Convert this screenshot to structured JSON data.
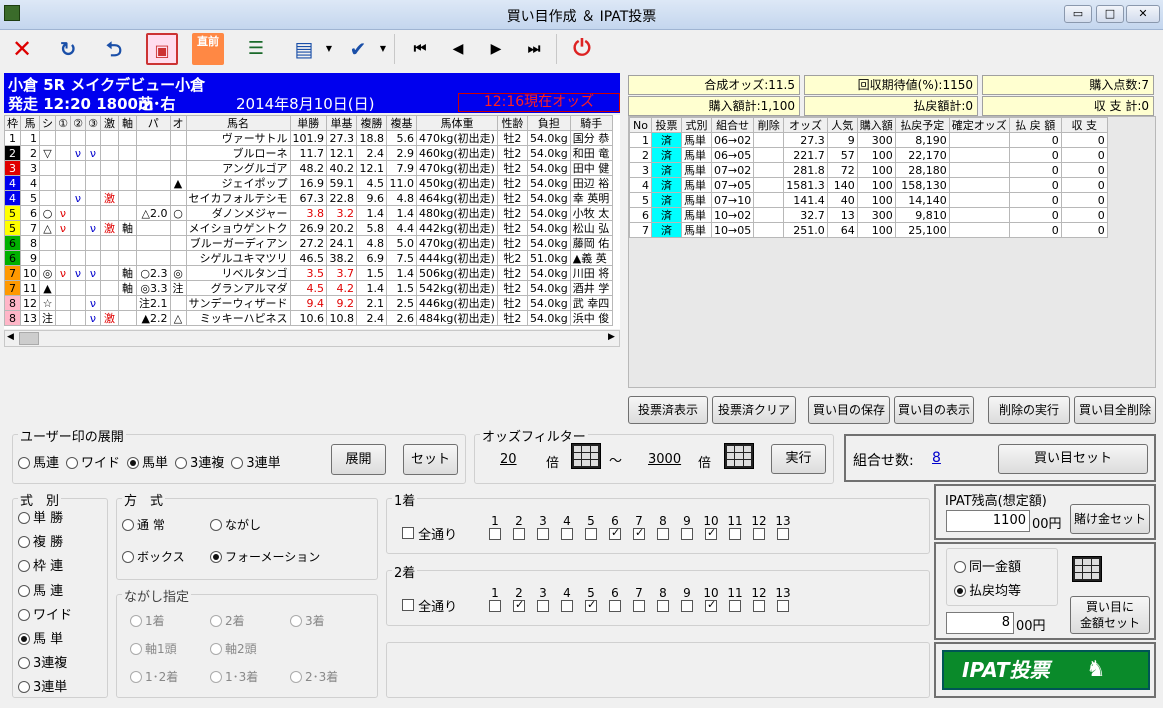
{
  "window": {
    "title": "買い目作成 ＆ IPAT投票",
    "min": "▭",
    "max": "□",
    "close": "✕"
  },
  "race": {
    "name": "小倉 5R メイクデビュー小倉",
    "start": "発走 12:20 1800m",
    "surface": "芝･右",
    "date": "2014年8月10日(日)",
    "odds_time": "12:16現在オッズ"
  },
  "horse_table": {
    "headers": [
      "枠",
      "馬",
      "シ",
      "①",
      "②",
      "③",
      "激",
      "軸",
      "パ",
      "オ",
      "馬名",
      "単勝",
      "単基",
      "複勝",
      "複基",
      "馬体重",
      "性齢",
      "負担",
      "騎手"
    ],
    "rows": [
      {
        "waku": "1",
        "uma": "1",
        "s": "",
        "m1": "",
        "m2": "",
        "m3": "",
        "geki": "",
        "jiku": "",
        "pa": "",
        "o": "",
        "name": "ヴァーサトル",
        "tan": "101.9",
        "tanki": "27.3",
        "fuku": "18.8",
        "fukuki": "5.6",
        "weight": "470kg(初出走)",
        "sexage": "牡2",
        "kinryo": "54.0kg",
        "jockey": "国分 恭"
      },
      {
        "waku": "2",
        "uma": "2",
        "s": "▽",
        "m1": "",
        "m2": "ν",
        "m3": "ν",
        "geki": "",
        "jiku": "",
        "pa": "",
        "o": "",
        "name": "ブルローネ",
        "tan": "11.7",
        "tanki": "12.1",
        "fuku": "2.4",
        "fukuki": "2.9",
        "weight": "460kg(初出走)",
        "sexage": "牡2",
        "kinryo": "54.0kg",
        "jockey": "和田 竜"
      },
      {
        "waku": "3",
        "uma": "3",
        "s": "",
        "m1": "",
        "m2": "",
        "m3": "",
        "geki": "",
        "jiku": "",
        "pa": "",
        "o": "",
        "name": "アングルゴア",
        "tan": "48.2",
        "tanki": "40.2",
        "fuku": "12.1",
        "fukuki": "7.9",
        "weight": "470kg(初出走)",
        "sexage": "牡2",
        "kinryo": "54.0kg",
        "jockey": "田中 健"
      },
      {
        "waku": "4",
        "uma": "4",
        "s": "",
        "m1": "",
        "m2": "",
        "m3": "",
        "geki": "",
        "jiku": "",
        "pa": "",
        "o": "▲",
        "name": "ジェイポップ",
        "tan": "16.9",
        "tanki": "59.1",
        "fuku": "4.5",
        "fukuki": "11.0",
        "weight": "450kg(初出走)",
        "sexage": "牡2",
        "kinryo": "54.0kg",
        "jockey": "田辺 裕"
      },
      {
        "waku": "4",
        "uma": "5",
        "s": "",
        "m1": "",
        "m2": "ν",
        "m3": "",
        "geki": "激",
        "jiku": "",
        "pa": "",
        "o": "",
        "name": "セイカフォルテシモ",
        "tan": "67.3",
        "tanki": "22.8",
        "fuku": "9.6",
        "fukuki": "4.8",
        "weight": "464kg(初出走)",
        "sexage": "牡2",
        "kinryo": "54.0kg",
        "jockey": "幸 英明"
      },
      {
        "waku": "5",
        "uma": "6",
        "s": "○",
        "m1": "ν",
        "m2": "",
        "m3": "",
        "geki": "",
        "jiku": "",
        "pa": "△2.0",
        "o": "○",
        "name": "ダノンメジャー",
        "tan": "3.8",
        "tanki": "3.2",
        "fuku": "1.4",
        "fukuki": "1.4",
        "weight": "480kg(初出走)",
        "sexage": "牡2",
        "kinryo": "54.0kg",
        "jockey": "小牧 太"
      },
      {
        "waku": "5",
        "uma": "7",
        "s": "△",
        "m1": "ν",
        "m2": "",
        "m3": "ν",
        "geki": "激",
        "jiku": "軸",
        "pa": "",
        "o": "",
        "name": "メイショウゲントク",
        "tan": "26.9",
        "tanki": "20.2",
        "fuku": "5.8",
        "fukuki": "4.4",
        "weight": "442kg(初出走)",
        "sexage": "牡2",
        "kinryo": "54.0kg",
        "jockey": "松山 弘"
      },
      {
        "waku": "6",
        "uma": "8",
        "s": "",
        "m1": "",
        "m2": "",
        "m3": "",
        "geki": "",
        "jiku": "",
        "pa": "",
        "o": "",
        "name": "ブルーガーディアン",
        "tan": "27.2",
        "tanki": "24.1",
        "fuku": "4.8",
        "fukuki": "5.0",
        "weight": "470kg(初出走)",
        "sexage": "牡2",
        "kinryo": "54.0kg",
        "jockey": "藤岡 佑"
      },
      {
        "waku": "6",
        "uma": "9",
        "s": "",
        "m1": "",
        "m2": "",
        "m3": "",
        "geki": "",
        "jiku": "",
        "pa": "",
        "o": "",
        "name": "シゲルユキマツリ",
        "tan": "46.5",
        "tanki": "38.2",
        "fuku": "6.9",
        "fukuki": "7.5",
        "weight": "444kg(初出走)",
        "sexage": "牝2",
        "kinryo": "51.0kg",
        "jockey": "▲義 英"
      },
      {
        "waku": "7",
        "uma": "10",
        "s": "◎",
        "m1": "ν",
        "m2": "ν",
        "m3": "ν",
        "geki": "",
        "jiku": "軸",
        "pa": "○2.3",
        "o": "◎",
        "name": "リベルタンゴ",
        "tan": "3.5",
        "tanki": "3.7",
        "fuku": "1.5",
        "fukuki": "1.4",
        "weight": "506kg(初出走)",
        "sexage": "牡2",
        "kinryo": "54.0kg",
        "jockey": "川田 将"
      },
      {
        "waku": "7",
        "uma": "11",
        "s": "▲",
        "m1": "",
        "m2": "",
        "m3": "",
        "geki": "",
        "jiku": "軸",
        "pa": "◎3.3",
        "o": "注",
        "name": "グランアルマダ",
        "tan": "4.5",
        "tanki": "4.2",
        "fuku": "1.4",
        "fukuki": "1.5",
        "weight": "542kg(初出走)",
        "sexage": "牡2",
        "kinryo": "54.0kg",
        "jockey": "酒井 学"
      },
      {
        "waku": "8",
        "uma": "12",
        "s": "☆",
        "m1": "",
        "m2": "",
        "m3": "ν",
        "geki": "",
        "jiku": "",
        "pa": "注2.1",
        "o": "",
        "name": "サンデーウィザード",
        "tan": "9.4",
        "tanki": "9.2",
        "fuku": "2.1",
        "fukuki": "2.5",
        "weight": "446kg(初出走)",
        "sexage": "牡2",
        "kinryo": "54.0kg",
        "jockey": "武 幸四"
      },
      {
        "waku": "8",
        "uma": "13",
        "s": "注",
        "m1": "",
        "m2": "",
        "m3": "ν",
        "geki": "激",
        "jiku": "",
        "pa": "▲2.2",
        "o": "△",
        "name": "ミッキーハピネス",
        "tan": "10.6",
        "tanki": "10.8",
        "fuku": "2.4",
        "fukuki": "2.6",
        "weight": "484kg(初出走)",
        "sexage": "牡2",
        "kinryo": "54.0kg",
        "jockey": "浜中 俊"
      }
    ]
  },
  "summary": {
    "gosei_odds": "合成オッズ:11.5",
    "kaishu": "回収期待値(%):1150",
    "kounyu_points": "購入点数:7",
    "kounyu_total": "購入額計:1,100",
    "haraimodoshi": "払戻額計:0",
    "shushi": "収 支 計:0"
  },
  "bet_table": {
    "headers": [
      "No",
      "投票",
      "式別",
      "組合せ",
      "削除",
      "オッズ",
      "人気",
      "購入額",
      "払戻予定",
      "確定オッズ",
      "払 戻 額",
      "収  支"
    ],
    "rows": [
      {
        "no": "1",
        "vote": "済",
        "type": "馬単",
        "combo": "06→02",
        "del": "",
        "odds": "27.3",
        "pop": "9",
        "amount": "300",
        "pay": "8,190",
        "kodds": "",
        "paid": "0",
        "net": "0"
      },
      {
        "no": "2",
        "vote": "済",
        "type": "馬単",
        "combo": "06→05",
        "del": "",
        "odds": "221.7",
        "pop": "57",
        "amount": "100",
        "pay": "22,170",
        "kodds": "",
        "paid": "0",
        "net": "0"
      },
      {
        "no": "3",
        "vote": "済",
        "type": "馬単",
        "combo": "07→02",
        "del": "",
        "odds": "281.8",
        "pop": "72",
        "amount": "100",
        "pay": "28,180",
        "kodds": "",
        "paid": "0",
        "net": "0"
      },
      {
        "no": "4",
        "vote": "済",
        "type": "馬単",
        "combo": "07→05",
        "del": "",
        "odds": "1581.3",
        "pop": "140",
        "amount": "100",
        "pay": "158,130",
        "kodds": "",
        "paid": "0",
        "net": "0"
      },
      {
        "no": "5",
        "vote": "済",
        "type": "馬単",
        "combo": "07→10",
        "del": "",
        "odds": "141.4",
        "pop": "40",
        "amount": "100",
        "pay": "14,140",
        "kodds": "",
        "paid": "0",
        "net": "0"
      },
      {
        "no": "6",
        "vote": "済",
        "type": "馬単",
        "combo": "10→02",
        "del": "",
        "odds": "32.7",
        "pop": "13",
        "amount": "300",
        "pay": "9,810",
        "kodds": "",
        "paid": "0",
        "net": "0"
      },
      {
        "no": "7",
        "vote": "済",
        "type": "馬単",
        "combo": "10→05",
        "del": "",
        "odds": "251.0",
        "pop": "64",
        "amount": "100",
        "pay": "25,100",
        "kodds": "",
        "paid": "0",
        "net": "0"
      }
    ]
  },
  "actions": {
    "voted_show": "投票済表示",
    "voted_clear": "投票済クリア",
    "save": "買い目の保存",
    "show": "買い目の表示",
    "delete_exec": "削除の実行",
    "delete_all": "買い目全削除"
  },
  "user_mark": {
    "legend": "ユーザー印の展開",
    "options": [
      "馬連",
      "ワイド",
      "馬単",
      "3連複",
      "3連単"
    ],
    "selected": "馬単",
    "expand": "展開",
    "set": "セット"
  },
  "odds_filter": {
    "legend": "オッズフィルター",
    "min": "20",
    "max": "3000",
    "unit": "倍",
    "tilde": "〜",
    "exec": "実行"
  },
  "combo": {
    "label": "組合せ数:",
    "count": "8",
    "set_button": "買い目セット"
  },
  "shikibetsu": {
    "legend": "式　別",
    "options": [
      "単 勝",
      "複 勝",
      "枠 連",
      "馬 連",
      "ワイド",
      "馬 単",
      "3連複",
      "3連単"
    ],
    "selected": "馬 単"
  },
  "houshiki": {
    "legend": "方　式",
    "options": [
      "通 常",
      "ながし",
      "ボックス",
      "フォーメーション"
    ],
    "selected": "フォーメーション"
  },
  "nagashi": {
    "legend": "ながし指定",
    "options": [
      "1着",
      "2着",
      "3着",
      "軸1頭",
      "軸2頭",
      "1･2着",
      "1･3着",
      "2･3着"
    ]
  },
  "first": {
    "legend": "1着",
    "all": "全通り",
    "numbers": [
      "1",
      "2",
      "3",
      "4",
      "5",
      "6",
      "7",
      "8",
      "9",
      "10",
      "11",
      "12",
      "13"
    ],
    "checked": [
      "6",
      "7",
      "10"
    ]
  },
  "second": {
    "legend": "2着",
    "all": "全通り",
    "numbers": [
      "1",
      "2",
      "3",
      "4",
      "5",
      "6",
      "7",
      "8",
      "9",
      "10",
      "11",
      "12",
      "13"
    ],
    "checked": [
      "2",
      "5",
      "10"
    ]
  },
  "ipat": {
    "zandaka_label": "IPAT残高(想定額)",
    "zandaka": "1100",
    "yen_unit": "00円",
    "kakekin_set": "賭け金セット",
    "same_amount": "同一金額",
    "payout_equal": "払戻均等",
    "amount_selected": "払戻均等",
    "amount": "8",
    "kingaku_set": "買い目に\n金額セット",
    "vote_banner": "IPAT投票"
  }
}
